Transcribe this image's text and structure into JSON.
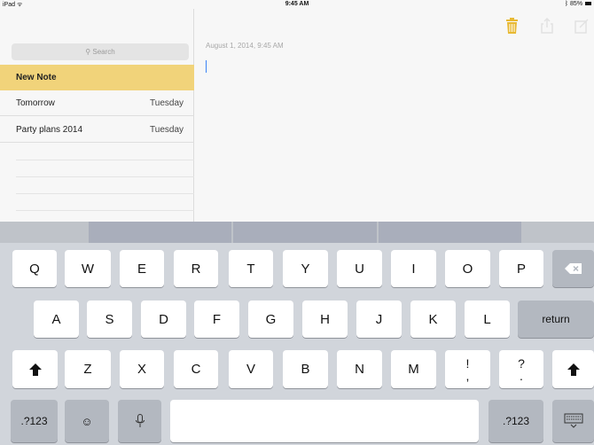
{
  "status": {
    "left": "iPad ᯤ",
    "time": "9:45 AM",
    "battery": "85%"
  },
  "sidebar": {
    "search_placeholder": "Search",
    "notes": [
      {
        "title": "New Note",
        "date": ""
      },
      {
        "title": "Tomorrow",
        "date": "Tuesday"
      },
      {
        "title": "Party plans 2014",
        "date": "Tuesday"
      }
    ]
  },
  "editor": {
    "datestamp": "August 1, 2014, 9:45 AM"
  },
  "keyboard": {
    "row1": [
      "Q",
      "W",
      "E",
      "R",
      "T",
      "Y",
      "U",
      "I",
      "O",
      "P"
    ],
    "row2": [
      "A",
      "S",
      "D",
      "F",
      "G",
      "H",
      "J",
      "K",
      "L"
    ],
    "row3": [
      "Z",
      "X",
      "C",
      "V",
      "B",
      "N",
      "M"
    ],
    "return_label": "return",
    "numbers_label": ".?123",
    "exclaim_top": "!",
    "exclaim_bottom": ",",
    "question_top": "?",
    "question_bottom": "."
  },
  "colors": {
    "accent": "#f1d37a",
    "toolbar_icon": "#e8b933"
  }
}
